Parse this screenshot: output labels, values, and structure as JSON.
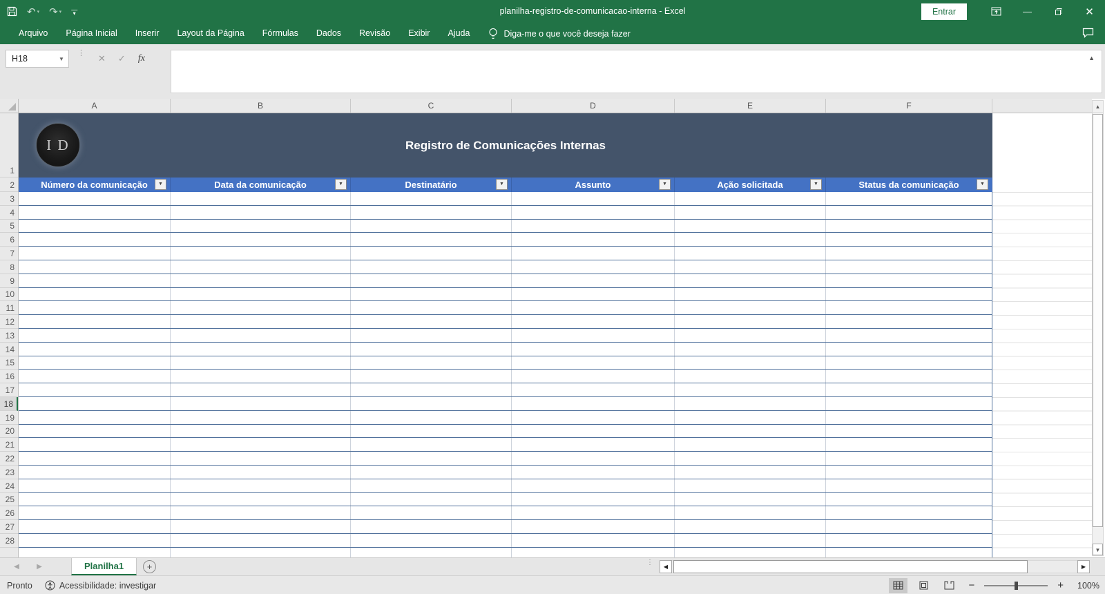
{
  "window": {
    "title": "planilha-registro-de-comunicacao-interna  -  Excel",
    "sign_in_label": "Entrar"
  },
  "menu": {
    "tabs": [
      "Arquivo",
      "Página Inicial",
      "Inserir",
      "Layout da Página",
      "Fórmulas",
      "Dados",
      "Revisão",
      "Exibir",
      "Ajuda"
    ],
    "tell_me": "Diga-me o que você deseja fazer"
  },
  "formula_bar": {
    "name_box": "H18",
    "fx_label": "fx",
    "formula_value": ""
  },
  "grid": {
    "columns": [
      "A",
      "B",
      "C",
      "D",
      "E",
      "F"
    ],
    "rows": [
      "1",
      "2",
      "3",
      "4",
      "5",
      "6",
      "7",
      "8",
      "9",
      "10",
      "11",
      "12",
      "13",
      "14",
      "15",
      "16",
      "17",
      "18",
      "19",
      "20",
      "21",
      "22",
      "23",
      "24",
      "25",
      "26",
      "27",
      "28"
    ],
    "selected_row": "18",
    "selected_cell": "H18"
  },
  "table": {
    "logo_text": "I D",
    "title": "Registro de Comunicações Internas",
    "headers": [
      "Número da comunicação",
      "Data da comunicação",
      "Destinatário",
      "Assunto",
      "Ação solicitada",
      "Status da comunicação"
    ]
  },
  "sheet_bar": {
    "active_tab": "Planilha1"
  },
  "status_bar": {
    "mode": "Pronto",
    "accessibility": "Acessibilidade: investigar",
    "zoom_level": "100%"
  },
  "colors": {
    "excel_green": "#217346",
    "banner": "#44546A",
    "header_blue": "#4472C4",
    "row_line": "#4E6F9A"
  }
}
